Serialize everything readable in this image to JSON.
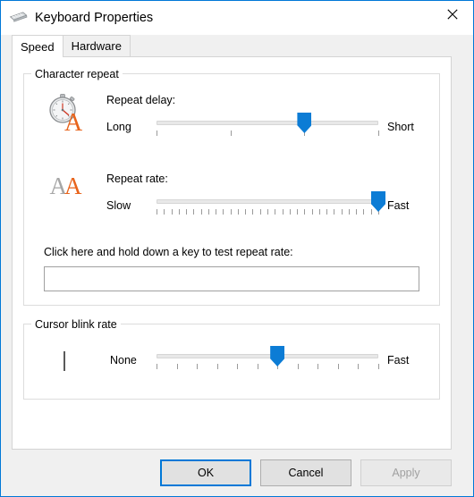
{
  "window": {
    "title": "Keyboard Properties",
    "icon": "keyboard-icon",
    "close_label": "✕",
    "accent_color": "#0078d7",
    "border_color": "#0078d7",
    "titlebar_background": "#ffffff",
    "body_background": "#f0f0f0"
  },
  "tabs": [
    {
      "label": "Speed",
      "selected": true
    },
    {
      "label": "Hardware",
      "selected": false
    }
  ],
  "groups": {
    "character_repeat": {
      "label": "Character repeat",
      "rows": [
        {
          "icon": "stopwatch-letter-a-icon",
          "title": "Repeat delay:",
          "min_label": "Long",
          "max_label": "Short",
          "ticks": 4,
          "value_index": 2,
          "value_percent": 66.7
        },
        {
          "icon": "double-letter-a-icon",
          "title": "Repeat rate:",
          "min_label": "Slow",
          "max_label": "Fast",
          "ticks": 31,
          "value_index": 30,
          "value_percent": 100
        }
      ],
      "test_label": "Click here and hold down a key to test repeat rate:",
      "test_value": "",
      "test_placeholder": ""
    },
    "cursor_blink_rate": {
      "label": "Cursor blink rate",
      "icon": "text-caret-icon",
      "min_label": "None",
      "max_label": "Fast",
      "ticks": 12,
      "value_index": 6,
      "value_percent": 54.5
    }
  },
  "footer": {
    "ok_label": "OK",
    "cancel_label": "Cancel",
    "apply_label": "Apply",
    "apply_disabled": true
  },
  "colors": {
    "slider_thumb": "#0c7cd5",
    "slider_track": "#e8e8e8",
    "icon_orange": "#e8641c",
    "icon_gray": "#a6a6a6",
    "group_border": "#dcdcdc"
  }
}
